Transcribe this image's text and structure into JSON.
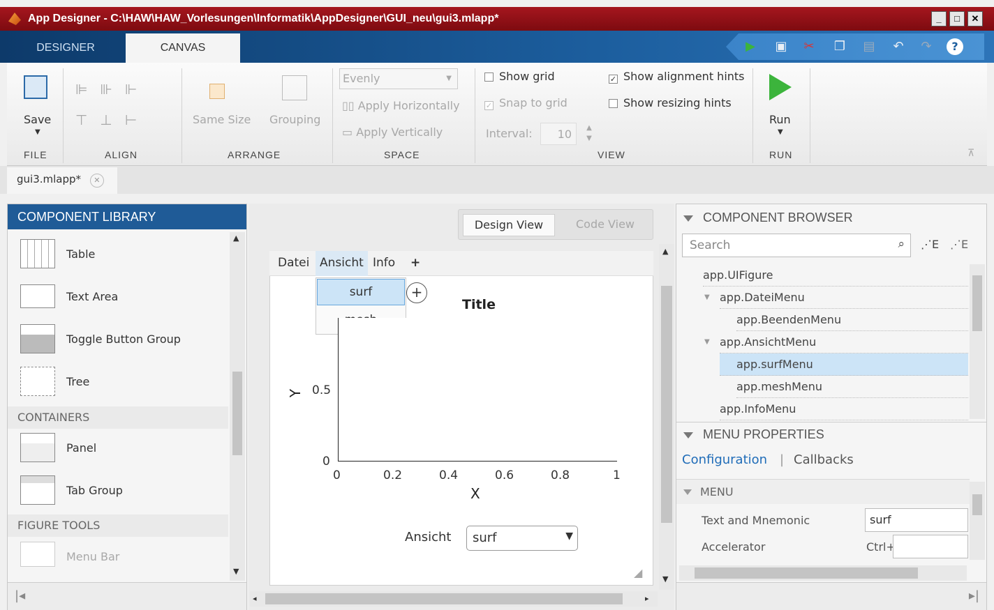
{
  "window": {
    "title": "App Designer - C:\\HAW\\HAW_Vorlesungen\\Informatik\\AppDesigner\\GUI_neu\\gui3.mlapp*"
  },
  "tabs": {
    "designer": "DESIGNER",
    "canvas": "CANVAS"
  },
  "ribbon": {
    "save": "Save",
    "same_size": "Same Size",
    "grouping": "Grouping",
    "evenly": "Evenly",
    "apply_horizontally": "Apply Horizontally",
    "apply_vertically": "Apply Vertically",
    "show_grid": "Show grid",
    "snap_to_grid": "Snap to grid",
    "interval_label": "Interval:",
    "interval_value": "10",
    "show_alignment_hints": "Show alignment hints",
    "show_resizing_hints": "Show resizing hints",
    "run": "Run",
    "groups": {
      "file": "FILE",
      "align": "ALIGN",
      "arrange": "ARRANGE",
      "space": "SPACE",
      "view": "VIEW",
      "run": "RUN"
    }
  },
  "doc_tab": "gui3.mlapp*",
  "library": {
    "header": "COMPONENT LIBRARY",
    "items": [
      "Table",
      "Text Area",
      "Toggle Button Group",
      "Tree"
    ],
    "containers_label": "CONTAINERS",
    "containers": [
      "Panel",
      "Tab Group"
    ],
    "figure_tools_label": "FIGURE TOOLS",
    "figure_tools": [
      "Menu Bar"
    ]
  },
  "canvas": {
    "design_view": "Design View",
    "code_view": "Code View",
    "menu": [
      "Datei",
      "Ansicht",
      "Info",
      "+"
    ],
    "dropdown": [
      "surf",
      "mesh"
    ],
    "plus": "+",
    "axes_title": "Title",
    "xlabel": "X",
    "ylabel": "Y",
    "xticks": [
      "0",
      "0.2",
      "0.4",
      "0.6",
      "0.8",
      "1"
    ],
    "yticks": [
      "0",
      "0.5"
    ],
    "ansicht_label": "Ansicht",
    "ansicht_value": "surf"
  },
  "browser": {
    "header": "COMPONENT BROWSER",
    "search_placeholder": "Search",
    "nodes": [
      "app.UIFigure",
      "app.DateiMenu",
      "app.BeendenMenu",
      "app.AnsichtMenu",
      "app.surfMenu",
      "app.meshMenu",
      "app.InfoMenu"
    ]
  },
  "properties": {
    "header": "MENU PROPERTIES",
    "configuration": "Configuration",
    "callbacks": "Callbacks",
    "section": "MENU",
    "text_label": "Text and Mnemonic",
    "text_value": "surf",
    "accel_label": "Accelerator",
    "accel_prefix": "Ctrl+"
  },
  "colors": {
    "title_bar": "#a5161e",
    "toolstrip": "#1c5e9e",
    "library_header": "#1f5b97",
    "selection": "#cce4f7",
    "run_green": "#3cb43c"
  }
}
